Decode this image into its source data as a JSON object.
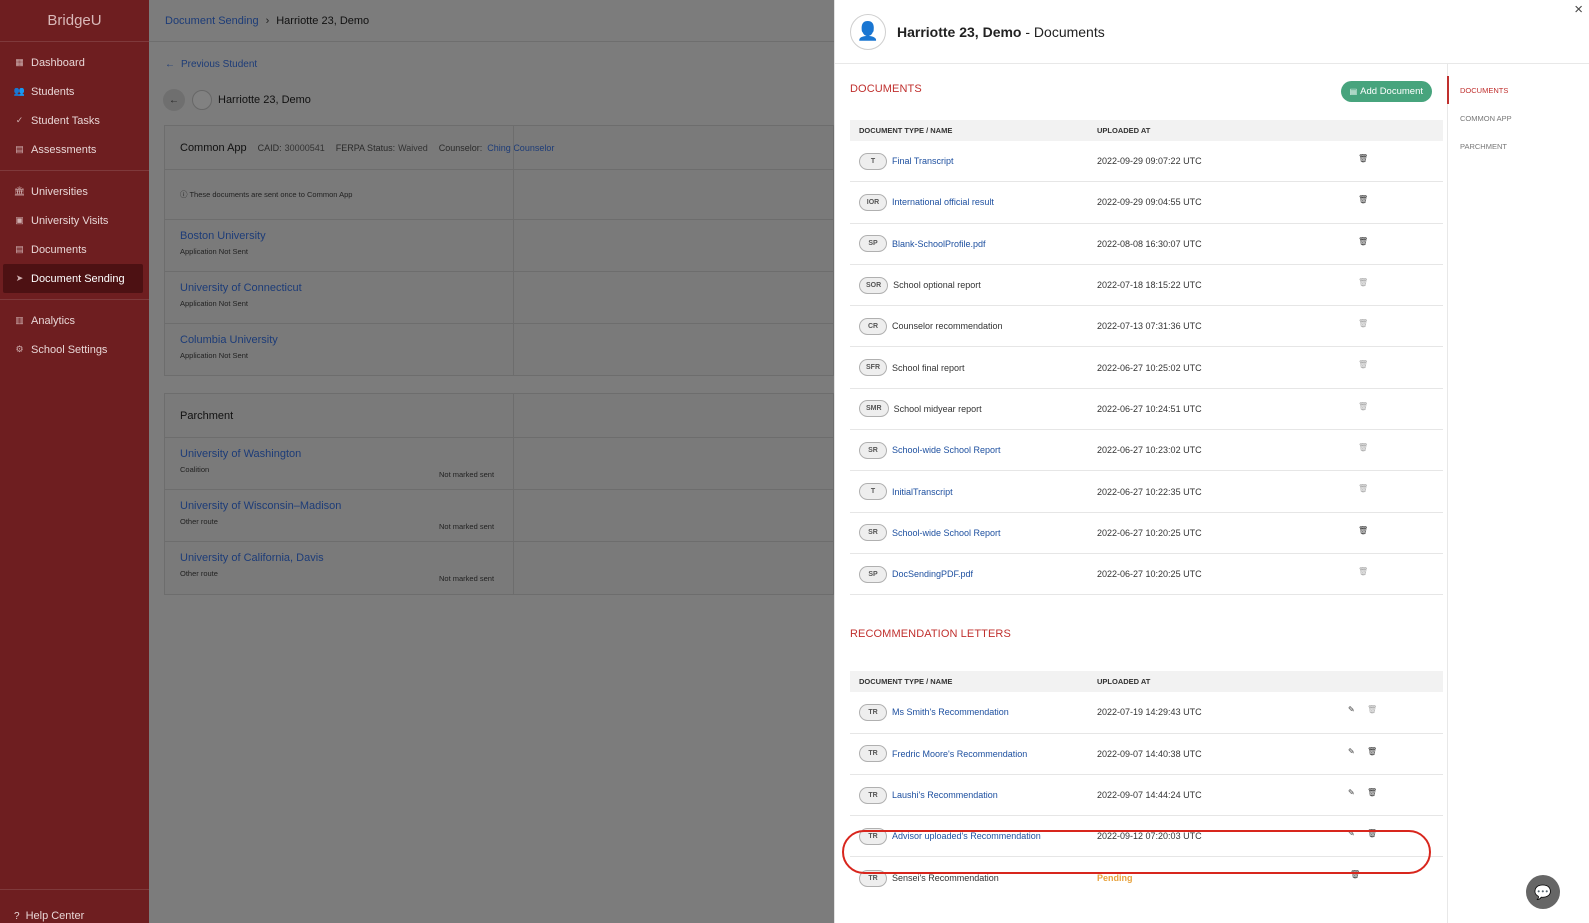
{
  "brand": "BridgeU",
  "nav": {
    "group1": [
      {
        "icon": "▦",
        "label": "Dashboard",
        "name": "dashboard"
      },
      {
        "icon": "👥",
        "label": "Students",
        "name": "students"
      },
      {
        "icon": "✓",
        "label": "Student Tasks",
        "name": "student-tasks"
      },
      {
        "icon": "▤",
        "label": "Assessments",
        "name": "assessments"
      }
    ],
    "group2": [
      {
        "icon": "🏛",
        "label": "Universities",
        "name": "universities"
      },
      {
        "icon": "▣",
        "label": "University Visits",
        "name": "university-visits"
      },
      {
        "icon": "▤",
        "label": "Documents",
        "name": "documents"
      },
      {
        "icon": "➤",
        "label": "Document Sending",
        "name": "document-sending",
        "active": true
      }
    ],
    "group3": [
      {
        "icon": "▥",
        "label": "Analytics",
        "name": "analytics"
      },
      {
        "icon": "⚙",
        "label": "School Settings",
        "name": "school-settings"
      }
    ],
    "help": "Help Center"
  },
  "breadcrumb": {
    "parent": "Document Sending",
    "current": "Harriotte 23, Demo"
  },
  "prev_student": "Previous Student",
  "student_name": "Harriotte 23, Demo",
  "common_app": {
    "title": "Common App",
    "caid_label": "CAID:",
    "caid": "30000541",
    "ferpa_label": "FERPA Status:",
    "ferpa": "Waived",
    "counselor_label": "Counselor:",
    "counselor": "Ching Counselor",
    "note": "ⓘ These documents are sent once to Common App",
    "unis": [
      {
        "name": "Boston University",
        "status": "Application Not Sent"
      },
      {
        "name": "University of Connecticut",
        "status": "Application Not Sent"
      },
      {
        "name": "Columbia University",
        "status": "Application Not Sent"
      }
    ]
  },
  "parchment": {
    "title": "Parchment",
    "unis": [
      {
        "name": "University of Washington",
        "status": "Coalition",
        "marked": "Not marked sent"
      },
      {
        "name": "University of Wisconsin–Madison",
        "status": "Other route",
        "marked": "Not marked sent"
      },
      {
        "name": "University of California, Davis",
        "status": "Other route",
        "marked": "Not marked sent"
      }
    ]
  },
  "panel": {
    "name": "Harriotte 23, Demo",
    "suffix": " - Documents",
    "close": "×",
    "documents_title": "DOCUMENTS",
    "add_document": "Add Document",
    "col_name": "DOCUMENT TYPE / NAME",
    "col_uploaded": "UPLOADED AT",
    "documents": [
      {
        "badge": "T",
        "name": "Final Transcript",
        "link": true,
        "date": "2022-09-29 09:07:22 UTC",
        "trash_dim": false
      },
      {
        "badge": "IOR",
        "name": "International official result",
        "link": true,
        "date": "2022-09-29 09:04:55 UTC",
        "trash_dim": false
      },
      {
        "badge": "SP",
        "name": "Blank-SchoolProfile.pdf",
        "link": true,
        "date": "2022-08-08 16:30:07 UTC",
        "trash_dim": false
      },
      {
        "badge": "SOR",
        "name": "School optional report",
        "link": false,
        "date": "2022-07-18 18:15:22 UTC",
        "trash_dim": true
      },
      {
        "badge": "CR",
        "name": "Counselor recommendation",
        "link": false,
        "date": "2022-07-13 07:31:36 UTC",
        "trash_dim": true
      },
      {
        "badge": "SFR",
        "name": "School final report",
        "link": false,
        "date": "2022-06-27 10:25:02 UTC",
        "trash_dim": true
      },
      {
        "badge": "SMR",
        "name": "School midyear report",
        "link": false,
        "date": "2022-06-27 10:24:51 UTC",
        "trash_dim": true
      },
      {
        "badge": "SR",
        "name": "School-wide School Report",
        "link": true,
        "date": "2022-06-27 10:23:02 UTC",
        "trash_dim": true
      },
      {
        "badge": "T",
        "name": "InitialTranscript",
        "link": true,
        "date": "2022-06-27 10:22:35 UTC",
        "trash_dim": true
      },
      {
        "badge": "SR",
        "name": "School-wide School Report",
        "link": true,
        "date": "2022-06-27 10:20:25 UTC",
        "trash_dim": false
      },
      {
        "badge": "SP",
        "name": "DocSendingPDF.pdf",
        "link": true,
        "date": "2022-06-27 10:20:25 UTC",
        "trash_dim": true
      }
    ],
    "rec_title": "RECOMMENDATION LETTERS",
    "recommendations": [
      {
        "badge": "TR",
        "name": "Ms Smith's Recommendation",
        "link": true,
        "date": "2022-07-19 14:29:43 UTC",
        "trash_dim": true
      },
      {
        "badge": "TR",
        "name": "Fredric Moore's Recommendation",
        "link": true,
        "date": "2022-09-07 14:40:38 UTC",
        "trash_dim": false
      },
      {
        "badge": "TR",
        "name": "Laushi's Recommendation",
        "link": true,
        "date": "2022-09-07 14:44:24 UTC",
        "trash_dim": false
      },
      {
        "badge": "TR",
        "name": "Advisor uploaded's Recommendation",
        "link": true,
        "date": "2022-09-12 07:20:03 UTC",
        "trash_dim": false
      }
    ],
    "pending_rec": {
      "badge": "TR",
      "name": "Sensei's Recommendation",
      "status": "Pending"
    },
    "right_nav": [
      "DOCUMENTS",
      "COMMON APP",
      "PARCHMENT"
    ]
  },
  "icons": {
    "trash": "🗑",
    "edit": "✎",
    "file": "▤",
    "back": "←",
    "chat": "💬"
  },
  "colors": {
    "brand": "#6e1e20",
    "accent_red": "#c0302e",
    "green": "#47a47d",
    "link": "#1e50a0",
    "pending": "#e8a23c"
  }
}
